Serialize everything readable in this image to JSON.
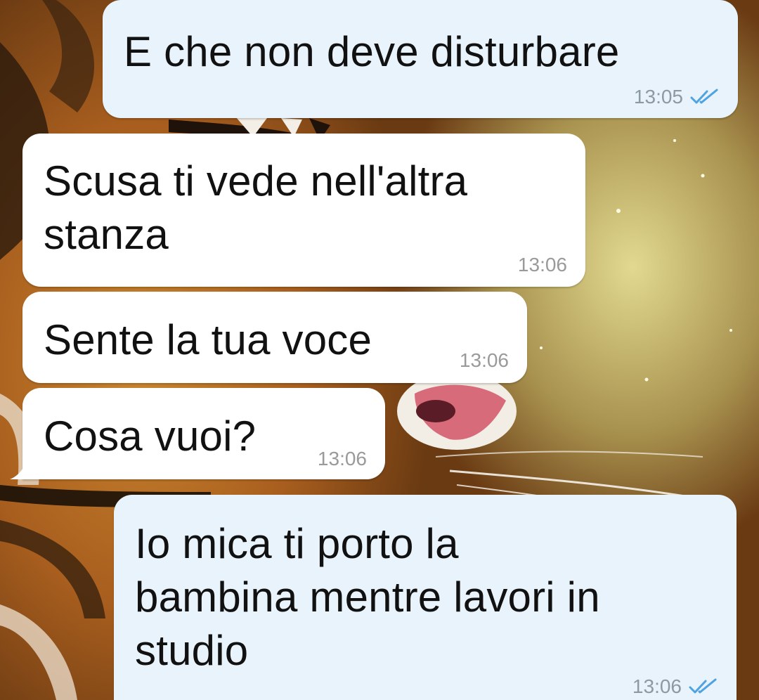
{
  "colors": {
    "outgoing_bubble": "#e8f3fb",
    "incoming_bubble": "#ffffff",
    "read_check": "#4fa3e0",
    "timestamp": "#8d9aa3"
  },
  "messages": [
    {
      "direction": "outgoing",
      "text": "E che non deve disturbare",
      "time": "13:05",
      "status_icon": "double-check-read-icon"
    },
    {
      "direction": "incoming",
      "text": "Scusa ti vede nell'altra\nstanza",
      "time": "13:06"
    },
    {
      "direction": "incoming",
      "text": "Sente la tua voce",
      "time": "13:06"
    },
    {
      "direction": "incoming",
      "text": "Cosa vuoi?",
      "time": "13:06"
    },
    {
      "direction": "outgoing",
      "text": "Io mica ti porto la\nbambina mentre lavori in\nstudio",
      "time": "13:06",
      "status_icon": "double-check-read-icon"
    }
  ]
}
